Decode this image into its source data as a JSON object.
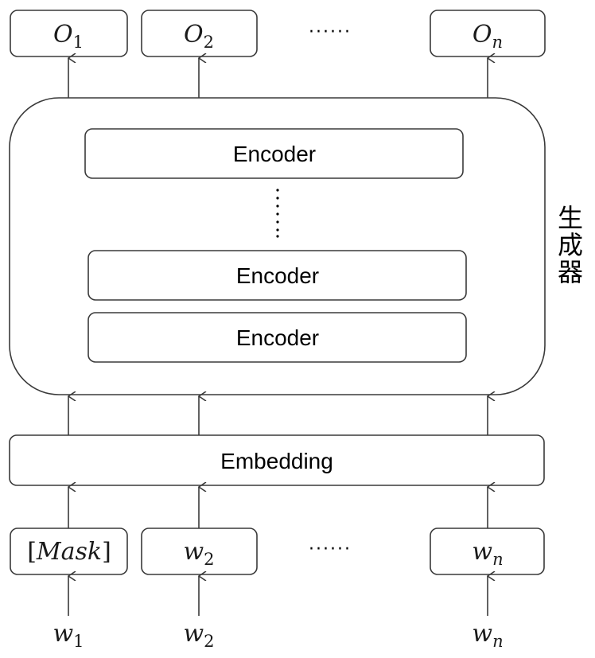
{
  "outputs": [
    {
      "symbol": "O",
      "sub": "1"
    },
    {
      "symbol": "O",
      "sub": "2"
    },
    {
      "symbol": "O",
      "sub": "n"
    }
  ],
  "outputs_ellipsis": "······",
  "generator": {
    "label": "生成器",
    "label_chars": [
      "生",
      "成",
      "器"
    ],
    "encoders": [
      "Encoder",
      "Encoder",
      "Encoder"
    ],
    "encoder_ellipsis": "vertical-dots"
  },
  "embedding": {
    "label": "Embedding"
  },
  "input_tokens": [
    {
      "kind": "mask",
      "open": "[",
      "text": "Mask",
      "close": "]"
    },
    {
      "kind": "word",
      "symbol": "w",
      "sub": "2"
    },
    {
      "kind": "word",
      "symbol": "w",
      "sub": "n"
    }
  ],
  "input_ellipsis": "······",
  "raw_words": [
    {
      "symbol": "w",
      "sub": "1"
    },
    {
      "symbol": "w",
      "sub": "2"
    },
    {
      "symbol": "w",
      "sub": "n"
    }
  ],
  "icons": {
    "arrow": "arrow-up-icon"
  }
}
